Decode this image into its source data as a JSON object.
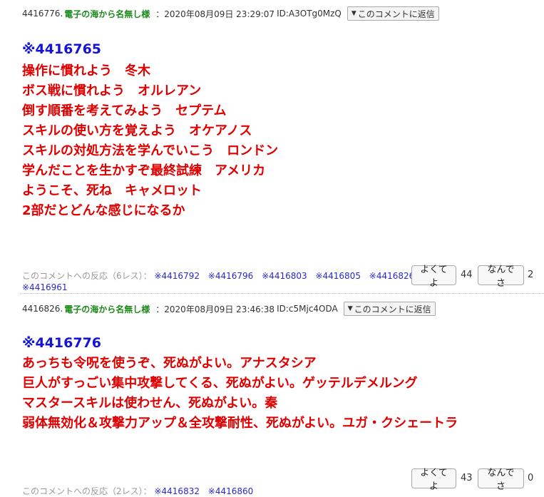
{
  "comments": [
    {
      "number": "4416776.",
      "name": "電子の海から名無し様",
      "date": "：2020年08月09日 23:29:07",
      "id": "ID:A3OTg0MzQ",
      "reply_label": "このコメントに返信",
      "anchor": "※4416765",
      "lines": [
        "操作に慣れよう　冬木",
        "ボス戦に慣れよう　オルレアン",
        "倒す順番を考えてみよう　セプテム",
        "スキルの使い方を覚えよう　オケアノス",
        "スキルの対処方法を学んでいこう　ロンドン",
        "学んだことを生かすぞ最終試練　アメリカ",
        "ようこそ、死ね　キャメロット",
        "2部だとどんな感じになるか"
      ],
      "reactions_label": "このコメントへの反応（6レス）：",
      "reaction_links": [
        "※4416792",
        "※4416796",
        "※4416803",
        "※4416805",
        "※4416826",
        "※4416961"
      ],
      "good_label": "よくてよ",
      "good_count": "44",
      "bad_label": "なんでさ",
      "bad_count": "2"
    },
    {
      "number": "4416826.",
      "name": "電子の海から名無し様",
      "date": "：2020年08月09日 23:46:38",
      "id": "ID:c5Mjc4ODA",
      "reply_label": "このコメントに返信",
      "anchor": "※4416776",
      "lines": [
        "あっちも令呪を使うぞ、死ぬがよい。アナスタシア",
        "巨人がすっごい集中攻撃してくる、死ぬがよい。ゲッテルデメルング",
        "マスタースキルは使わせん、死ぬがよい。秦",
        "弱体無効化＆攻撃力アップ＆全攻撃耐性、死ぬがよい。ユガ・クシェートラ"
      ],
      "reactions_label": "このコメントへの反応（2レス）：",
      "reaction_links": [
        "※4416832",
        "※4416860"
      ],
      "good_label": "よくてよ",
      "good_count": "43",
      "bad_label": "なんでさ",
      "bad_count": "0"
    }
  ]
}
